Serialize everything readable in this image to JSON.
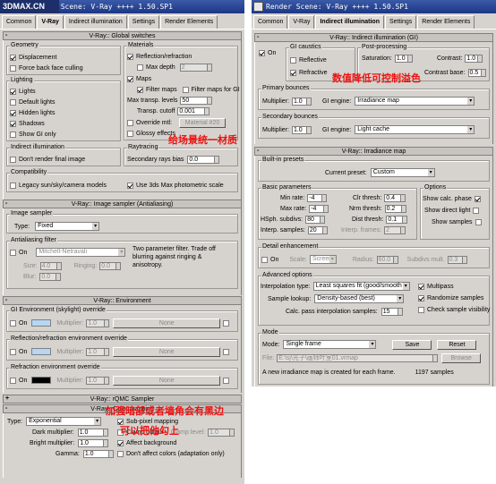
{
  "watermark": "3DMAX.CN",
  "left": {
    "title": "Render Scene: V-Ray ++++ 1.50.SP1",
    "tabs": [
      "Common",
      "V-Ray",
      "Indirect illumination",
      "Settings",
      "Render Elements"
    ],
    "global_switches": {
      "header": "V-Ray:: Global switches",
      "geometry": {
        "title": "Geometry",
        "displacement": "Displacement",
        "force_back": "Force back face culling"
      },
      "lighting": {
        "title": "Lighting",
        "lights": "Lights",
        "default_lights": "Default lights",
        "hidden_lights": "Hidden lights",
        "shadows": "Shadows",
        "show_gi": "Show GI only"
      },
      "indirect": {
        "title": "Indirect illumination",
        "dont_render": "Don't render final image"
      },
      "compat": {
        "title": "Compatibility",
        "legacy": "Legacy sun/sky/camera models",
        "use3ds": "Use 3ds Max photometric scale"
      },
      "materials": {
        "title": "Materials",
        "reflection": "Reflection/refraction",
        "max_depth": "Max depth",
        "max_depth_val": "2",
        "maps": "Maps",
        "filter_maps": "Filter maps",
        "filter_gi": "Filter maps for GI",
        "max_transp": "Max transp. levels",
        "max_transp_val": "50",
        "transp_cutoff": "Transp. cutoff",
        "transp_cutoff_val": "0.001",
        "override": "Override mtl:",
        "override_btn": "Material #20",
        "glossy": "Glossy effects"
      },
      "raytracing": {
        "title": "Raytracing",
        "secondary": "Secondary rays bias",
        "secondary_val": "0.0"
      }
    },
    "image_sampler": {
      "header": "V-Ray:: Image sampler (Antialiasing)",
      "sampler": {
        "title": "Image sampler",
        "type_label": "Type:",
        "type_val": "Fixed"
      },
      "aa": {
        "title": "Antialiasing filter",
        "on": "On",
        "filter": "Mitchell-Netravali",
        "desc": "Two parameter filter. Trade off blurring against ringing & anisotropy.",
        "size": "Size:",
        "size_val": "4.0",
        "ringing": "Ringing:",
        "ringing_val": "0.0",
        "blur": "Blur:",
        "blur_val": "0.0"
      }
    },
    "environment": {
      "header": "V-Ray:: Environment",
      "gi": {
        "title": "GI Environment (skylight) override",
        "on": "On",
        "mult": "Multiplier:",
        "mult_val": "1.0",
        "none": "None"
      },
      "refl": {
        "title": "Reflection/refraction environment override",
        "on": "On",
        "mult": "Multiplier:",
        "mult_val": "1.0",
        "none": "None"
      },
      "refr": {
        "title": "Refraction environment override",
        "on": "On",
        "mult": "Multiplier:",
        "mult_val": "1.0",
        "none": "None"
      }
    },
    "qmc_header": "V-Ray:: rQMC Sampler",
    "color_mapping": {
      "header": "V-Ray:: Color mapping",
      "type_label": "Type:",
      "type_val": "Exponential",
      "sub_pixel": "Sub-pixel mapping",
      "clamp": "Clamp output",
      "clamp_level": "Clamp level:",
      "clamp_level_val": "1.0",
      "affect_bg": "Affect background",
      "dont_affect": "Don't affect colors (adaptation only)",
      "dark": "Dark multiplier:",
      "dark_val": "1.0",
      "bright": "Bright multiplier:",
      "bright_val": "1.0",
      "gamma": "Gamma:",
      "gamma_val": "1.0"
    }
  },
  "right": {
    "title": "Render Scene: V-Ray ++++ 1.50.SP1",
    "tabs": [
      "Common",
      "V-Ray",
      "Indirect illumination",
      "Settings",
      "Render Elements"
    ],
    "indirect": {
      "header": "V-Ray:: Indirect illumination (GI)",
      "on": "On",
      "caustics": {
        "title": "GI caustics",
        "reflective": "Reflective",
        "refractive": "Refractive"
      },
      "post": {
        "title": "Post-processing",
        "saturation": "Saturation:",
        "saturation_val": "1.0",
        "contrast": "Contrast:",
        "contrast_val": "1.0",
        "contrast_base": "Contrast base:",
        "contrast_base_val": "0.5"
      },
      "primary": {
        "title": "Primary bounces",
        "mult": "Multiplier:",
        "mult_val": "1.0",
        "engine": "GI engine:",
        "engine_val": "Irradiance map"
      },
      "secondary": {
        "title": "Secondary bounces",
        "mult": "Multiplier:",
        "mult_val": "1.0",
        "engine": "GI engine:",
        "engine_val": "Light cache"
      }
    },
    "irradiance": {
      "header": "V-Ray:: Irradiance map",
      "presets": {
        "title": "Built-in presets",
        "current": "Current preset:",
        "current_val": "Custom"
      },
      "basic": {
        "title": "Basic parameters",
        "min_rate": "Min rate:",
        "min_rate_val": "-4",
        "max_rate": "Max rate:",
        "max_rate_val": "-4",
        "hsph": "HSph. subdivs:",
        "hsph_val": "80",
        "interp": "Interp. samples:",
        "interp_val": "20",
        "clr": "Clr thresh:",
        "clr_val": "0.4",
        "nrm": "Nrm thresh:",
        "nrm_val": "0.2",
        "dist": "Dist thresh:",
        "dist_val": "0.1",
        "interp_frames": "Interp. frames:",
        "interp_frames_val": "2"
      },
      "options": {
        "title": "Options",
        "show_calc": "Show calc. phase",
        "show_direct": "Show direct light",
        "show_samples": "Show samples"
      },
      "detail": {
        "title": "Detail enhancement",
        "on": "On",
        "scale": "Scale:",
        "scale_val": "Screen",
        "radius": "Radius:",
        "radius_val": "60.0",
        "subdivs": "Subdivs mult.",
        "subdivs_val": "0.3"
      },
      "advanced": {
        "title": "Advanced options",
        "interp_type": "Interpolation type:",
        "interp_type_val": "Least squares fit (good/smooth",
        "lookup": "Sample lookup:",
        "lookup_val": "Density-based (best)",
        "calc_pass": "Calc. pass interpolation samples:",
        "calc_pass_val": "15",
        "multipass": "Multipass",
        "randomize": "Randomize samples",
        "check_vis": "Check sample visibility"
      },
      "mode": {
        "title": "Mode",
        "mode_label": "Mode:",
        "mode_val": "Single frame",
        "save": "Save",
        "reset": "Reset",
        "file": "File:",
        "file_val": "E:\\sj\\光子\\画师叶室01.vrmap",
        "browse": "Browse",
        "new_map": "A new irradiance map is created for each frame.",
        "samples": "1197 samples"
      }
    }
  },
  "annotations": {
    "a1": "数值降低可控制溢色",
    "a2": "给场景统一材质",
    "a3": "加强暗部或者墙角会有黑边",
    "a4": "可以把他勾上"
  }
}
